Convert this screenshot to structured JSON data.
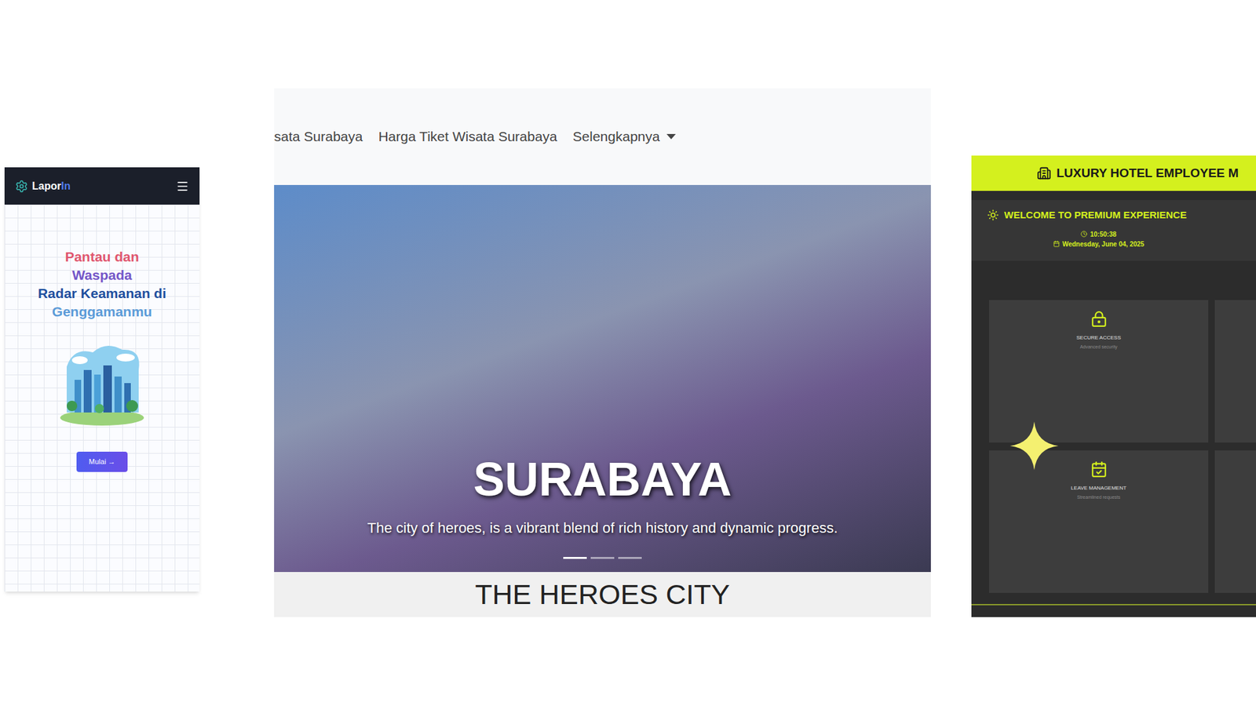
{
  "left_app": {
    "brand": {
      "name": "Lapor",
      "accent": "In"
    },
    "headline": [
      {
        "text": "Pantau dan",
        "color": "#e0566e"
      },
      {
        "text": "Waspada",
        "color": "#7456c8"
      },
      {
        "text": "Radar Keamanan di",
        "color": "#1f4f9e"
      },
      {
        "text": "Genggamanmu",
        "color": "#5b9bd8"
      }
    ],
    "button": "Mulai →"
  },
  "middle_site": {
    "nav": [
      {
        "label": "sata Surabaya",
        "dropdown": false
      },
      {
        "label": "Harga Tiket Wisata Surabaya",
        "dropdown": false
      },
      {
        "label": "Selengkapnya",
        "dropdown": true
      }
    ],
    "hero": {
      "title": "SURABAYA",
      "caption": "The city of heroes, is a vibrant blend of rich history and dynamic progress.",
      "indicators": [
        {
          "selected": true
        },
        {
          "selected": false
        },
        {
          "selected": false
        }
      ]
    },
    "band": "THE HEROES CITY"
  },
  "right_app": {
    "header": "LUXURY HOTEL EMPLOYEE M",
    "welcome": "WELCOME TO PREMIUM EXPERIENCE",
    "time": "10:50:38",
    "date": "Wednesday, June 04, 2025",
    "cards": [
      {
        "title": "SECURE ACCESS",
        "subtitle": "Advanced security"
      },
      {
        "title": "LEAVE MANAGEMENT",
        "subtitle": "Streamlined requests"
      }
    ]
  }
}
